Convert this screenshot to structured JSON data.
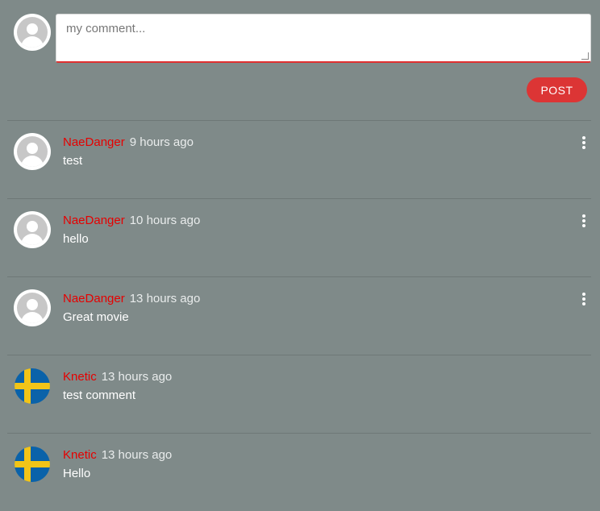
{
  "composer": {
    "placeholder": "my comment...",
    "post_label": "POST"
  },
  "comments": [
    {
      "author": "NaeDanger",
      "time": "9 hours ago",
      "text": "test",
      "avatar": "default-user-avatar",
      "has_menu": true
    },
    {
      "author": "NaeDanger",
      "time": "10 hours ago",
      "text": "hello",
      "avatar": "default-user-avatar",
      "has_menu": true
    },
    {
      "author": "NaeDanger",
      "time": "13 hours ago",
      "text": "Great movie",
      "avatar": "default-user-avatar",
      "has_menu": true
    },
    {
      "author": "Knetic",
      "time": "13 hours ago",
      "text": "test comment",
      "avatar": "sweden-flag-avatar",
      "has_menu": false
    },
    {
      "author": "Knetic",
      "time": "13 hours ago",
      "text": "Hello",
      "avatar": "sweden-flag-avatar",
      "has_menu": false
    }
  ],
  "colors": {
    "background": "#7f8a89",
    "author": "#e60000",
    "post_button": "#dc3535",
    "input_underline": "#e03030"
  }
}
